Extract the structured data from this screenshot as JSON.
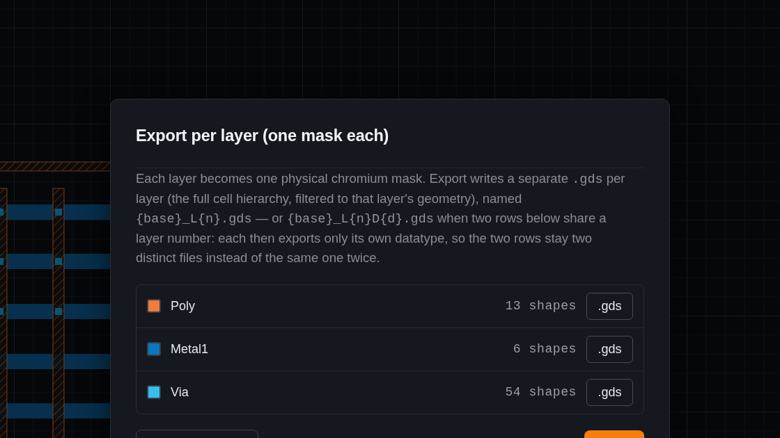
{
  "dialog": {
    "title": "Export per layer (one mask each)",
    "description": [
      {
        "kind": "text",
        "text": "Each layer becomes one physical chromium mask. Export writes a separate "
      },
      {
        "kind": "code",
        "text": ".gds"
      },
      {
        "kind": "text",
        "text": " per layer (the full cell hierarchy, filtered to that layer's geometry), named "
      },
      {
        "kind": "code",
        "text": "{base}_L{n}.gds"
      },
      {
        "kind": "text",
        "text": " — or "
      },
      {
        "kind": "code",
        "text": "{base}_L{n}D{d}.gds"
      },
      {
        "kind": "text",
        "text": " when two rows below share a layer number: each then exports only its own datatype, so the two rows stay two distinct files instead of the same one twice."
      }
    ],
    "layers": [
      {
        "name": "Poly",
        "color": "#ef7d3b",
        "count": "13 shapes",
        "button": ".gds"
      },
      {
        "name": "Metal1",
        "color": "#0a78c0",
        "count": "6 shapes",
        "button": ".gds"
      },
      {
        "name": "Via",
        "color": "#38bdf0",
        "count": "54 shapes",
        "button": ".gds"
      }
    ],
    "footer_buttons": [
      {
        "kind": "secondary"
      },
      {
        "kind": "primary"
      }
    ]
  }
}
